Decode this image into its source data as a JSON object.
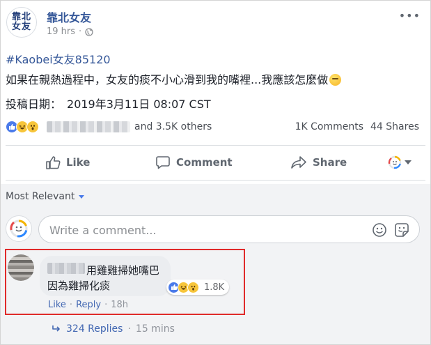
{
  "post": {
    "page_logo_text": [
      "靠北",
      "女友"
    ],
    "page_name": "靠北女友",
    "time_ago": "19 hrs",
    "hashtag": "#Kaobei女友85120",
    "body": "如果在親熱過程中，女友的痰不小心滑到我的嘴裡...我應該怎麼做",
    "date_label": "投稿日期：",
    "date_value": "2019年3月11日 08:07 CST",
    "reaction_others": "and 3.5K others",
    "comments_count": "1K Comments",
    "shares_count": "44 Shares"
  },
  "actions": {
    "like": "Like",
    "comment": "Comment",
    "share": "Share"
  },
  "comments": {
    "sort_label": "Most Relevant",
    "input_placeholder": "Write a comment...",
    "top_comment": {
      "line1": "用雞雞掃她嘴巴",
      "line2": "因為雞掃化痰",
      "reaction_count": "1.8K",
      "like": "Like",
      "reply": "Reply",
      "separator": "·",
      "time": "18h"
    },
    "replies": {
      "count": "324 Replies",
      "separator": "·",
      "time": "15 mins"
    }
  },
  "icons": [
    "globe-icon",
    "more-icon",
    "like-reaction-icon",
    "haha-reaction-icon",
    "wow-reaction-icon",
    "thumbs-up-icon",
    "comment-icon",
    "share-icon",
    "reaction-selector-icon",
    "emoji-icon",
    "sticker-icon",
    "reply-arrow-icon"
  ],
  "colors": {
    "link": "#365899",
    "like_blue": "#4b7bea",
    "highlight": "#e02a2a",
    "comments_bg": "#f2f3f5"
  }
}
